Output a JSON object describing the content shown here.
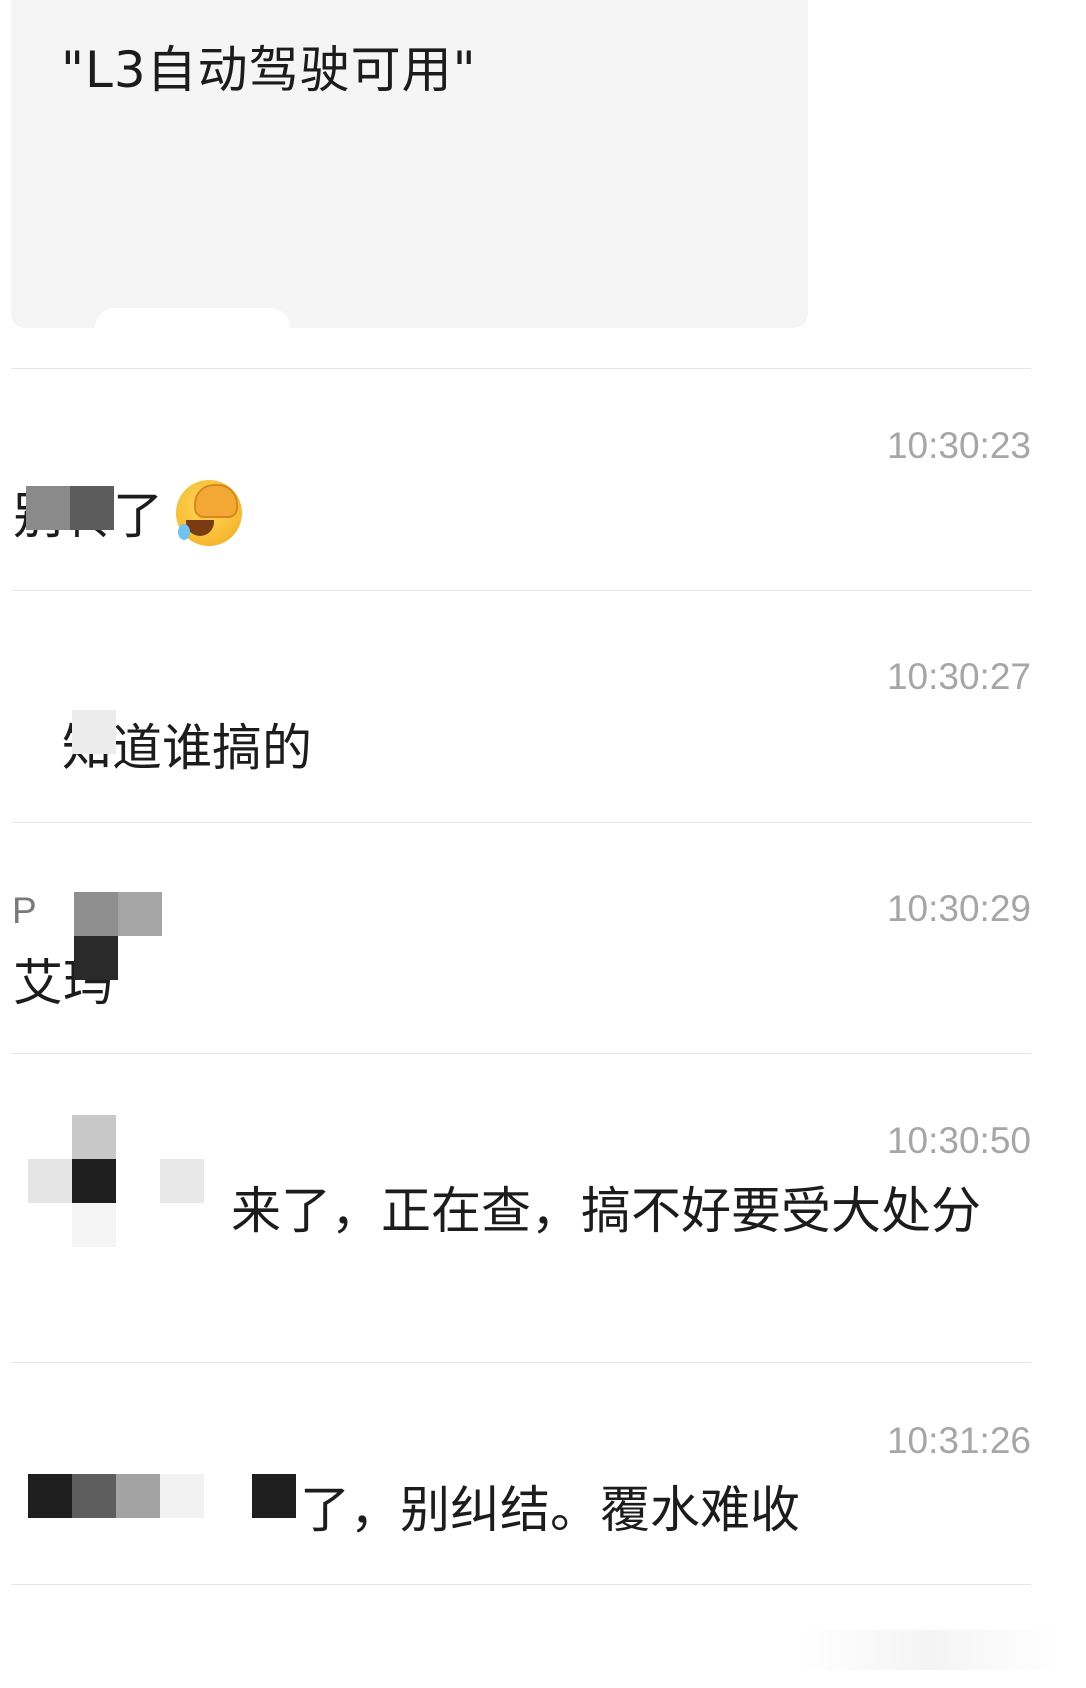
{
  "quote": {
    "text": "\"L3自动驾驶可用\""
  },
  "messages": [
    {
      "time": "10:30:23",
      "text": "别转了"
    },
    {
      "time": "10:30:27",
      "text": "知道谁搞的"
    },
    {
      "time": "10:30:29",
      "sender": "P",
      "text": "艾玛"
    },
    {
      "time": "10:30:50",
      "text": "来了，正在查，搞不好要受大处分"
    },
    {
      "time": "10:31:26",
      "text": "了，别纠结。覆水难收"
    }
  ],
  "emoji": {
    "name": "face-palm-crying-emoji"
  },
  "colors": {
    "card_bg": "#f5f5f5",
    "divider": "#e6e6e6",
    "timestamp": "#a6a6a6",
    "text": "#1c1c1c"
  }
}
